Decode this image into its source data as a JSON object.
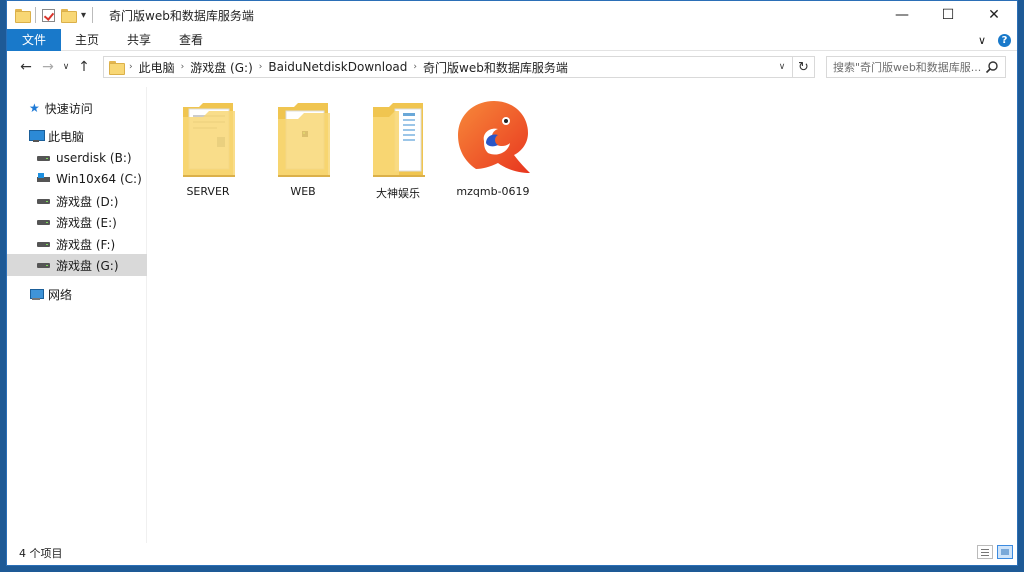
{
  "window": {
    "title": "奇门版web和数据库服务端",
    "controls": {
      "minimize": "—",
      "maximize": "☐",
      "close": "✕"
    }
  },
  "ribbon": {
    "tabs": [
      "文件",
      "主页",
      "共享",
      "查看"
    ],
    "collapse": "∨",
    "help": "?"
  },
  "navigation": {
    "back": "←",
    "forward": "→",
    "recent": "∨",
    "up": "↑",
    "breadcrumb": [
      "此电脑",
      "游戏盘 (G:)",
      "BaiduNetdiskDownload",
      "奇门版web和数据库服务端"
    ],
    "separator": "›",
    "dropdown": "∨",
    "refresh": "↻"
  },
  "search": {
    "placeholder": "搜索\"奇门版web和数据库服..."
  },
  "sidebar": {
    "quick_access": "快速访问",
    "this_pc": "此电脑",
    "drives": [
      {
        "label": "userdisk (B:)",
        "icon": "drive-icon"
      },
      {
        "label": "Win10x64 (C:)",
        "icon": "windows-drive-icon"
      },
      {
        "label": "游戏盘 (D:)",
        "icon": "drive-icon"
      },
      {
        "label": "游戏盘 (E:)",
        "icon": "drive-icon"
      },
      {
        "label": "游戏盘 (F:)",
        "icon": "drive-icon"
      },
      {
        "label": "游戏盘 (G:)",
        "icon": "drive-icon",
        "selected": true
      }
    ],
    "network": "网络"
  },
  "content": {
    "items": [
      {
        "name": "SERVER",
        "type": "folder",
        "icon": "folder-with-documents-icon"
      },
      {
        "name": "WEB",
        "type": "folder",
        "icon": "folder-with-file-icon"
      },
      {
        "name": "大神娱乐",
        "type": "folder",
        "icon": "folder-with-documents-icon"
      },
      {
        "name": "mzqmb-0619",
        "type": "application",
        "icon": "orange-fish-app-icon"
      }
    ]
  },
  "status": {
    "count": "4 个项目"
  },
  "colors": {
    "accent": "#1979ca",
    "folder": "#f8d775",
    "selected": "#d9d9d9",
    "app_orange": "#f0582a"
  }
}
